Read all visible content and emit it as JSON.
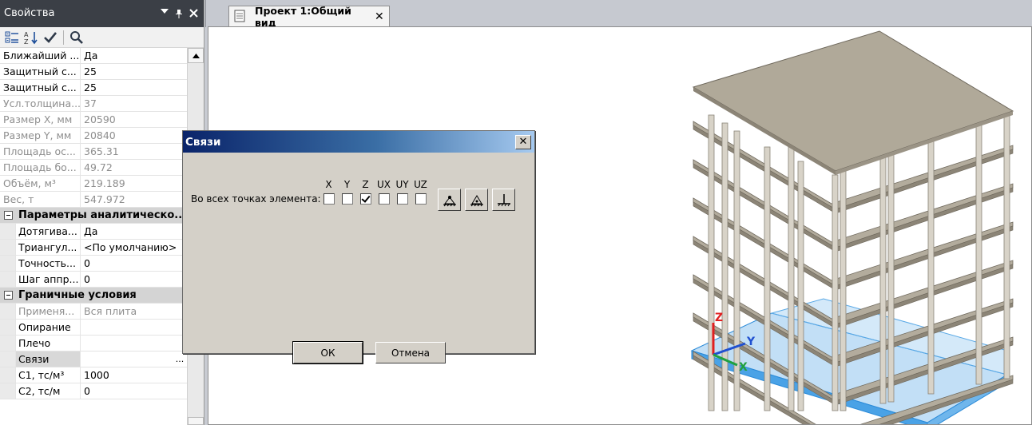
{
  "properties_panel": {
    "title": "Свойства",
    "rows": [
      {
        "key": "Ближайший ...",
        "value": "Да"
      },
      {
        "key": "Защитный с...",
        "value": "25"
      },
      {
        "key": "Защитный с...",
        "value": "25"
      },
      {
        "key": "Усл.толщина...",
        "value": "37"
      },
      {
        "key": "Размер X, мм",
        "value": "20590"
      },
      {
        "key": "Размер Y, мм",
        "value": "20840"
      },
      {
        "key": "Площадь ос...",
        "value": "365.31"
      },
      {
        "key": "Площадь бо...",
        "value": "49.72"
      },
      {
        "key": "Объём, м³",
        "value": "219.189"
      },
      {
        "key": "Вес, т",
        "value": "547.972"
      }
    ],
    "category_analytic": "Параметры аналитическо...",
    "analytic_rows": [
      {
        "key": "Дотягива...",
        "value": "Да"
      },
      {
        "key": "Триангул...",
        "value": "<По умолчанию>"
      },
      {
        "key": "Точность...",
        "value": "0"
      },
      {
        "key": "Шаг аппр...",
        "value": "0"
      }
    ],
    "category_boundary": "Граничные условия",
    "boundary_rows": [
      {
        "key": "Применя...",
        "value": "Вся плита"
      },
      {
        "key": "Опирание",
        "value": ""
      },
      {
        "key": "Плечо",
        "value": ""
      },
      {
        "key": "Связи",
        "value": "",
        "ellipsis": "..."
      },
      {
        "key": "C1, тс/м³",
        "value": "1000"
      },
      {
        "key": "C2, тс/м",
        "value": "0"
      }
    ]
  },
  "document": {
    "tab_label": "Проект 1:Общий вид",
    "axis_labels": {
      "z": "Z",
      "y": "Y",
      "x": "X"
    },
    "colors": {
      "slab_top": "#b3ac9d",
      "slab_edge": "#8c8577",
      "foundation": "#7db9ea",
      "column": "#d8d3c8"
    }
  },
  "dialog": {
    "title": "Связи",
    "all_points_label": "Во всех точках элемента:",
    "axes": [
      {
        "name": "X",
        "checked": false
      },
      {
        "name": "Y",
        "checked": false
      },
      {
        "name": "Z",
        "checked": true
      },
      {
        "name": "UX",
        "checked": false
      },
      {
        "name": "UY",
        "checked": false
      },
      {
        "name": "UZ",
        "checked": false
      }
    ],
    "support_buttons": [
      "hinged-support-icon",
      "fixed-support-icon",
      "clamped-support-icon"
    ],
    "ok_label": "ОК",
    "cancel_label": "Отмена"
  }
}
